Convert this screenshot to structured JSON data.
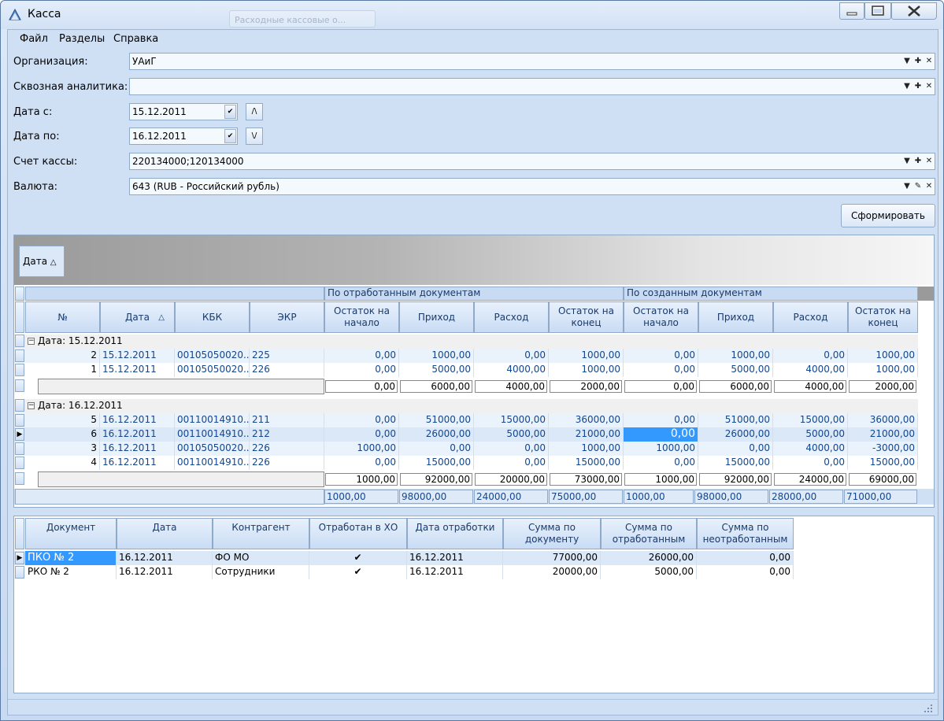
{
  "window": {
    "title": "Касса",
    "ghost_tab": "Расходные кассовые о..."
  },
  "menu": {
    "items": [
      "Файл",
      "Разделы",
      "Справка"
    ]
  },
  "filters": {
    "organization": {
      "label": "Организация:",
      "value": "УАиГ"
    },
    "analytics": {
      "label": "Сквозная аналитика:",
      "value": ""
    },
    "date_from": {
      "label": "Дата с:",
      "value": "15.12.2011",
      "step": "/\\"
    },
    "date_to": {
      "label": "Дата по:",
      "value": "16.12.2011",
      "step": "\\/"
    },
    "cash_account": {
      "label": "Счет кассы:",
      "value": "220134000;120134000"
    },
    "currency": {
      "label": "Валюта:",
      "value": "643 (RUB - Российский рубль)"
    }
  },
  "form_button": "Сформировать",
  "grid": {
    "group_chip": "Дата",
    "band_worked": "По отработанным документам",
    "band_created": "По созданным документам",
    "columns": [
      "№",
      "Дата",
      "КБК",
      "ЭКР",
      "Остаток на начало",
      "Приход",
      "Расход",
      "Остаток на конец",
      "Остаток на начало",
      "Приход",
      "Расход",
      "Остаток на конец"
    ],
    "groups": [
      {
        "title": "Дата: 15.12.2011",
        "rows": [
          [
            "2",
            "15.12.2011",
            "00105050020...",
            "225",
            "0,00",
            "1000,00",
            "0,00",
            "1000,00",
            "0,00",
            "1000,00",
            "0,00",
            "1000,00"
          ],
          [
            "1",
            "15.12.2011",
            "00105050020...",
            "226",
            "0,00",
            "5000,00",
            "4000,00",
            "1000,00",
            "0,00",
            "5000,00",
            "4000,00",
            "1000,00"
          ]
        ],
        "totals": [
          "0,00",
          "6000,00",
          "4000,00",
          "2000,00",
          "0,00",
          "6000,00",
          "4000,00",
          "2000,00"
        ]
      },
      {
        "title": "Дата: 16.12.2011",
        "rows": [
          [
            "5",
            "16.12.2011",
            "00110014910...",
            "211",
            "0,00",
            "51000,00",
            "15000,00",
            "36000,00",
            "0,00",
            "51000,00",
            "15000,00",
            "36000,00"
          ],
          [
            "6",
            "16.12.2011",
            "00110014910...",
            "212",
            "0,00",
            "26000,00",
            "5000,00",
            "21000,00",
            "0,00",
            "26000,00",
            "5000,00",
            "21000,00"
          ],
          [
            "3",
            "16.12.2011",
            "00105050020...",
            "226",
            "1000,00",
            "0,00",
            "0,00",
            "1000,00",
            "1000,00",
            "0,00",
            "4000,00",
            "-3000,00"
          ],
          [
            "4",
            "16.12.2011",
            "00110014910...",
            "226",
            "0,00",
            "15000,00",
            "0,00",
            "15000,00",
            "0,00",
            "15000,00",
            "0,00",
            "15000,00"
          ]
        ],
        "totals": [
          "1000,00",
          "92000,00",
          "20000,00",
          "73000,00",
          "1000,00",
          "92000,00",
          "24000,00",
          "69000,00"
        ]
      }
    ],
    "grand_totals": [
      "1000,00",
      "98000,00",
      "24000,00",
      "75000,00",
      "1000,00",
      "98000,00",
      "28000,00",
      "71000,00"
    ]
  },
  "docs": {
    "columns": [
      "Документ",
      "Дата",
      "Контрагент",
      "Отработан в ХО",
      "Дата отработки",
      "Сумма по документу",
      "Сумма по отработанным",
      "Сумма по неотработанным"
    ],
    "rows": [
      [
        "ПКО № 2",
        "16.12.2011",
        "ФО МО",
        "✔",
        "16.12.2011",
        "77000,00",
        "26000,00",
        "0,00"
      ],
      [
        "РКО № 2",
        "16.12.2011",
        "Сотрудники",
        "✔",
        "16.12.2011",
        "20000,00",
        "5000,00",
        "0,00"
      ]
    ]
  },
  "colors": {
    "selection": "#3399ff",
    "header_text": "#1a3a6a",
    "value_text": "#13468c"
  }
}
